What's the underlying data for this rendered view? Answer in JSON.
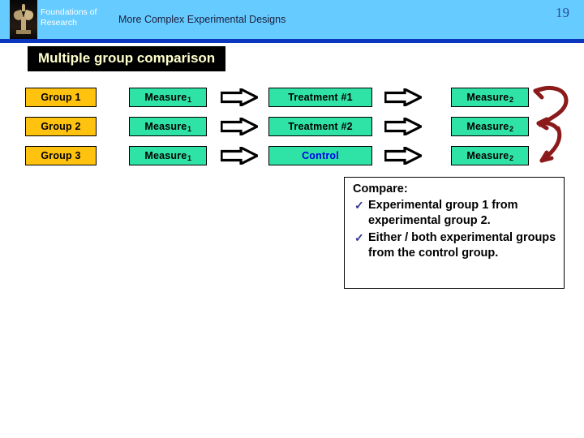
{
  "header": {
    "brand": "Foundations of Research",
    "deck_title": "More Complex Experimental Designs",
    "page_number": "19",
    "band_color": "#66ccff",
    "rule_color": "#0b37bf",
    "brand_color": "#ffffff",
    "page_number_color": "#2b4a9e",
    "logo_icon": "statue-logo-icon"
  },
  "section": {
    "title": "Multiple group comparison",
    "title_color": "#ffffcc",
    "plate_color": "#000000"
  },
  "diagram": {
    "group_box_color": "#ffc20e",
    "stage_box_color": "#2fe2a6",
    "control_text_color": "#0000ee",
    "arrow_fill": "#ffffff",
    "arrow_stroke": "#000000",
    "brace_color": "#8b1a1a",
    "columns": [
      "Group",
      "Measure 1",
      "Treatment / Control",
      "Measure 2"
    ],
    "rows": [
      {
        "group": "Group 1",
        "measure_pre": "Measure",
        "measure_pre_sub": "1",
        "middle": "Treatment  #1",
        "middle_kind": "treatment",
        "measure_post": "Measure",
        "measure_post_sub": "2",
        "arrow_1": "right-arrow-icon",
        "arrow_2": "right-arrow-icon"
      },
      {
        "group": "Group 2",
        "measure_pre": "Measure",
        "measure_pre_sub": "1",
        "middle": "Treatment  #2",
        "middle_kind": "treatment",
        "measure_post": "Measure",
        "measure_post_sub": "2",
        "arrow_1": "right-arrow-icon",
        "arrow_2": "right-arrow-icon"
      },
      {
        "group": "Group 3",
        "measure_pre": "Measure",
        "measure_pre_sub": "1",
        "middle": "Control",
        "middle_kind": "control",
        "measure_post": "Measure",
        "measure_post_sub": "2",
        "arrow_1": "right-arrow-icon",
        "arrow_2": "right-arrow-icon"
      }
    ],
    "brace_annotation": "hand-drawn-red-brace-icon"
  },
  "compare": {
    "heading": "Compare:",
    "check_glyph": "✓",
    "check_color": "#333399",
    "items": [
      "Experimental group 1 from experimental group 2.",
      "Either / both experimental groups from the control group."
    ]
  }
}
